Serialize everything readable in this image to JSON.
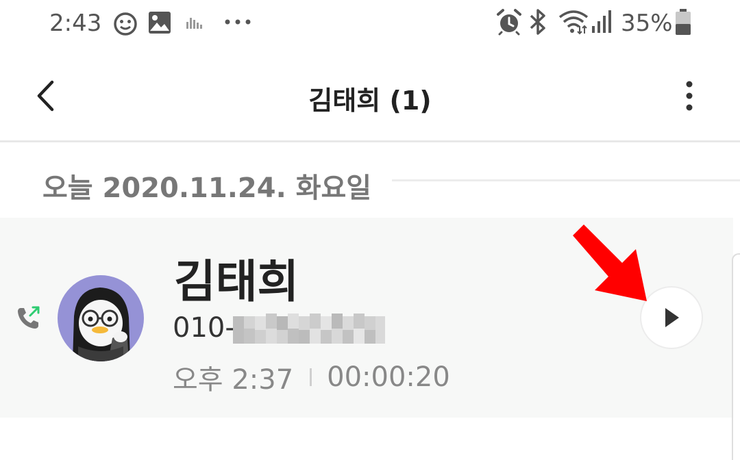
{
  "status_bar": {
    "time": "2:43",
    "battery_percent": "35%",
    "left_icons": [
      "smiley-icon",
      "gallery-icon",
      "sound-wave-icon",
      "more-dots-icon"
    ],
    "right_icons": [
      "alarm-icon",
      "bluetooth-icon",
      "wifi-icon",
      "signal-icon",
      "battery-icon"
    ]
  },
  "app_bar": {
    "title": "김태희 (1)",
    "back_icon": "chevron-left-icon",
    "more_icon": "kebab-menu-icon"
  },
  "date_header": {
    "label": "오늘 2020.11.24. 화요일"
  },
  "call_entry": {
    "contact_name": "김태희",
    "phone_number_prefix": "010-",
    "time": "오후 2:37",
    "duration": "00:00:20",
    "direction_icon": "outgoing-call-icon",
    "action_icon": "play-icon"
  },
  "colors": {
    "accent_green": "#2ecc71",
    "arrow_red": "#ff0000",
    "card_background": "#f7f8f7",
    "avatar_background": "#9592d6"
  }
}
